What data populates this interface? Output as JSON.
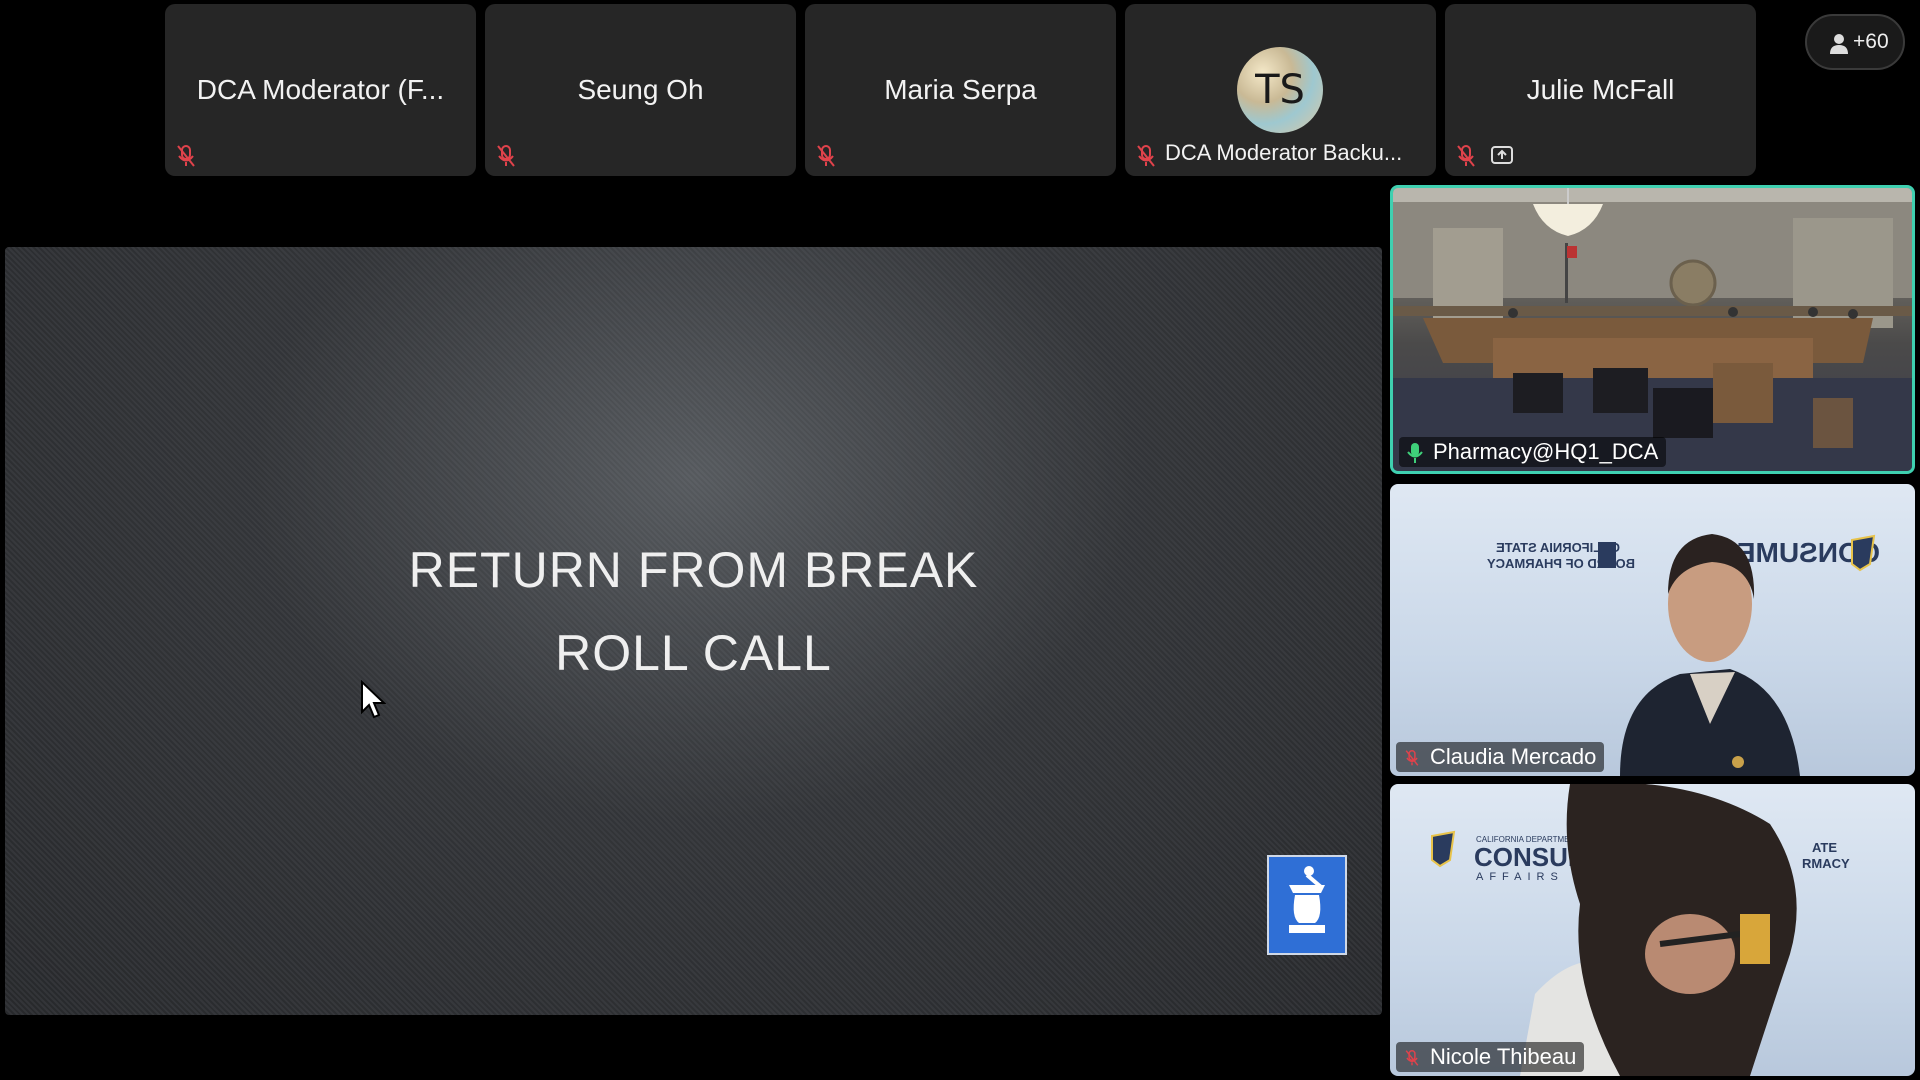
{
  "participants": [
    {
      "name": "DCA Moderator (F...",
      "muted": true
    },
    {
      "name": "Seung Oh",
      "muted": true
    },
    {
      "name": "Maria Serpa",
      "muted": true
    },
    {
      "name": "DCA Moderator Backu...",
      "initials": "TS",
      "muted": true
    },
    {
      "name": "Julie McFall",
      "muted": true,
      "sharing": true
    }
  ],
  "participant_overflow": "+60",
  "slide": {
    "line1": "RETURN FROM BREAK",
    "line2": "ROLL CALL"
  },
  "videos": [
    {
      "name": "Pharmacy@HQ1_DCA",
      "muted": false,
      "active_speaker": true
    },
    {
      "name": "Claudia Mercado",
      "muted": true
    },
    {
      "name": "Nicole Thibeau",
      "muted": true
    }
  ],
  "backdrop_text": {
    "board_line1": "CALIFORNIA STATE",
    "board_line2": "BOARD OF PHARMACY",
    "dept_line1": "CALIFORNIA DEPARTMENT OF",
    "dept_line2": "CONSUMER",
    "dept_line3": "AFFAIRS",
    "partial_line1": "ATE",
    "partial_line2": "RMACY"
  },
  "colors": {
    "active_speaker_border": "#3fd0b0",
    "mute_icon": "#e0424b",
    "unmuted_mic": "#3fd07a"
  }
}
